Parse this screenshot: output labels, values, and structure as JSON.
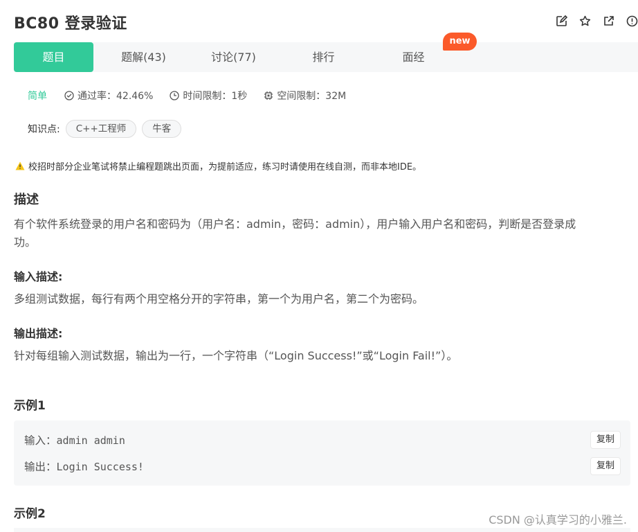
{
  "problem": {
    "title": "BC80  登录验证"
  },
  "header_icons": [
    "edit-icon",
    "star-icon",
    "external-link-icon",
    "info-icon"
  ],
  "tabs": [
    {
      "label": "题目",
      "active": true
    },
    {
      "label": "题解(43)",
      "active": false
    },
    {
      "label": "讨论(77)",
      "active": false
    },
    {
      "label": "排行",
      "active": false
    },
    {
      "label": "面经",
      "active": false
    }
  ],
  "new_badge": "new",
  "meta": {
    "difficulty": "简单",
    "pass_rate": "通过率：42.46%",
    "time_limit": "时间限制：1秒",
    "space_limit": "空间限制：32M"
  },
  "knowledge": {
    "label": "知识点:",
    "tags": [
      "C++工程师",
      "牛客"
    ]
  },
  "warning": "校招时部分企业笔试将禁止编程题跳出页面，为提前适应，练习时请使用在线自测，而非本地IDE。",
  "description": {
    "heading": "描述",
    "text_line1": "有个软件系统登录的用户名和密码为（用户名：admin，密码：admin），用户输入用户名和密码，判断是否登录成",
    "text_line2": "功。"
  },
  "input_desc": {
    "heading": "输入描述:",
    "text": "多组测试数据，每行有两个用空格分开的字符串，第一个为用户名，第二个为密码。"
  },
  "output_desc": {
    "heading": "输出描述:",
    "text": "针对每组输入测试数据，输出为一行，一个字符串（“Login Success!”或“Login Fail!”）。"
  },
  "example1": {
    "heading": "示例1",
    "input_label": "输入：",
    "input_value": "admin admin",
    "output_label": "输出：",
    "output_value": "Login Success!",
    "copy_label": "复制"
  },
  "example2": {
    "heading": "示例2"
  },
  "watermark": "CSDN @认真学习的小雅兰.",
  "colors": {
    "accent": "#32ca99",
    "badge": "#fb5a2a",
    "warning": "#f5c518"
  }
}
